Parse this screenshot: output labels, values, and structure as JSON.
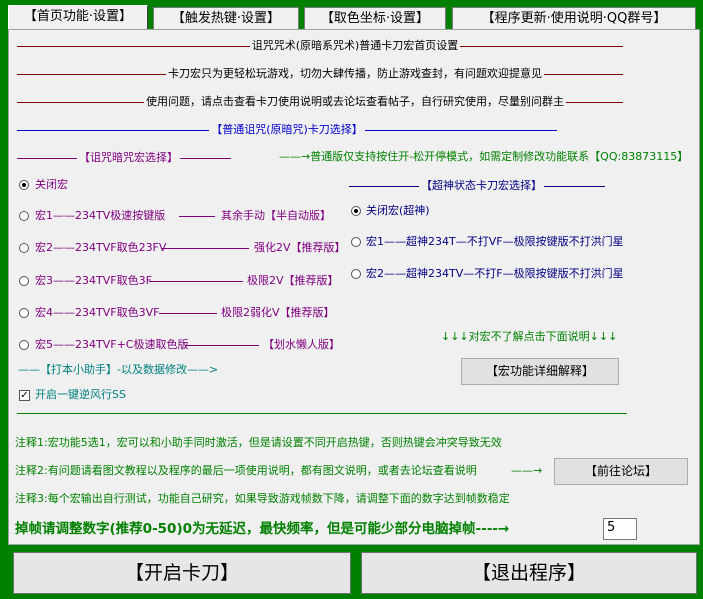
{
  "tabs": [
    {
      "label": "【首页功能·设置】"
    },
    {
      "label": "【触发热键·设置】"
    },
    {
      "label": "【取色坐标·设置】"
    },
    {
      "label": "【程序更新·使用说明·QQ群号】"
    }
  ],
  "header": {
    "line1": "诅咒咒术(原暗系咒术)普通卡刀宏首页设置",
    "line2": "卡刀宏只为更轻松玩游戏，切勿大肆传播，防止游戏查封，有问题欢迎提意见",
    "line3": "使用问题，请点击查看卡刀使用说明或去论坛查看帖子，自行研究使用，尽量别问群主"
  },
  "section_title": "【普通诅咒(原暗咒)卡刀选择】",
  "left": {
    "title": "【诅咒暗咒宏选择】",
    "options": [
      {
        "label": "关闭宏",
        "suffix": "",
        "checked": true
      },
      {
        "label": "宏1——234TV极速按键版",
        "suffix": "其余手动【半自动版】",
        "checked": false
      },
      {
        "label": "宏2——234TVF取色23FV",
        "suffix": "强化2V【推荐版】",
        "checked": false
      },
      {
        "label": "宏3——234TVF取色3F",
        "suffix": "极限2V【推荐版】",
        "checked": false
      },
      {
        "label": "宏4——234TVF取色3VF",
        "suffix": "极限2弱化V【推荐版】",
        "checked": false
      },
      {
        "label": "宏5——234TVF+C极速取色版",
        "suffix": "【划水懒人版】",
        "checked": false
      }
    ]
  },
  "right": {
    "notice": "普通版仅支持按住开-松开停模式，如需定制修改功能联系【QQ:83873115】",
    "title": "【超神状态卡刀宏选择】",
    "options": [
      {
        "label": "关闭宏(超神)",
        "checked": true
      },
      {
        "label": "宏1——超神234T—不打VF—极限按键版不打洪门星",
        "checked": false
      },
      {
        "label": "宏2——超神234TV—不打F—极限按键版不打洪门星",
        "checked": false
      }
    ],
    "hint": "↓↓↓对宏不了解点击下面说明↓↓↓",
    "detail_button": "【宏功能详细解释】"
  },
  "helper": {
    "title": "——【打本小助手】-以及数据修改——>",
    "checkbox_label": "开启一键逆风行SS",
    "checked": true
  },
  "notes": {
    "note1": "注释1:宏功能5选1，宏可以和小助手同时激活，但是请设置不同开启热键，否则热键会冲突导致无效",
    "note2": "注释2:有问题请看图文教程以及程序的最后一项使用说明，都有图文说明，或者去论坛查看说明",
    "note2_button": "【前往论坛】",
    "note3": "注释3:每个宏输出自行测试，功能自己研究，如果导致游戏帧数下降，请调整下面的数字达到帧数稳定"
  },
  "frame": {
    "label": "掉帧请调整数字(推荐0-50)0为无延迟，最快频率，但是可能少部分电脑掉帧",
    "value": "5"
  },
  "bottom": {
    "start_button": "【开启卡刀】",
    "exit_button": "【退出程序】"
  }
}
